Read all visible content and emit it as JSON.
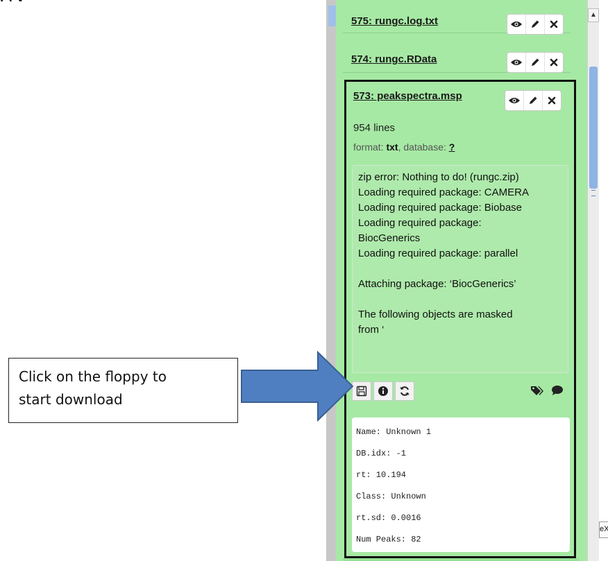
{
  "caption_partial": "r   r   t",
  "history": {
    "items": [
      {
        "title": "575: rungc.log.txt"
      },
      {
        "title": "574: rungc.RData"
      }
    ],
    "expanded": {
      "title": "573: peakspectra.msp",
      "lines": "954 lines",
      "format_label": "format: ",
      "format_value": "txt",
      "database_label": ", database: ",
      "database_value": "?",
      "stderr_lines": [
        "zip error: Nothing to do! (rungc.zip)",
        "Loading required package: CAMERA",
        "Loading required package: Biobase",
        "Loading required package:",
        "BiocGenerics",
        "Loading required package: parallel",
        "",
        "Attaching package: ‘BiocGenerics’",
        "",
        "The following objects are masked",
        "from ‘"
      ],
      "peek_rows": [
        "Name: Unknown 1",
        "DB.idx: -1",
        "rt: 10.194",
        "Class: Unknown",
        "rt.sd: 0.0016",
        "Num Peaks: 82"
      ]
    }
  },
  "icons": {
    "view": "eye-icon",
    "edit": "pencil-icon",
    "delete": "close-icon",
    "download": "floppy-disk-icon",
    "info": "info-icon",
    "rerun": "refresh-icon",
    "tags": "tags-icon",
    "annotate": "comment-icon"
  },
  "callout": {
    "line1": "Click on the floppy to",
    "line2": "start download"
  },
  "edge_tab_text": "eX",
  "colors": {
    "dataset_ok": "#a6e9a4",
    "arrow_fill": "#4f7fc1",
    "arrow_stroke": "#3a5f91",
    "scroll_thumb": "#8eb3e4"
  }
}
